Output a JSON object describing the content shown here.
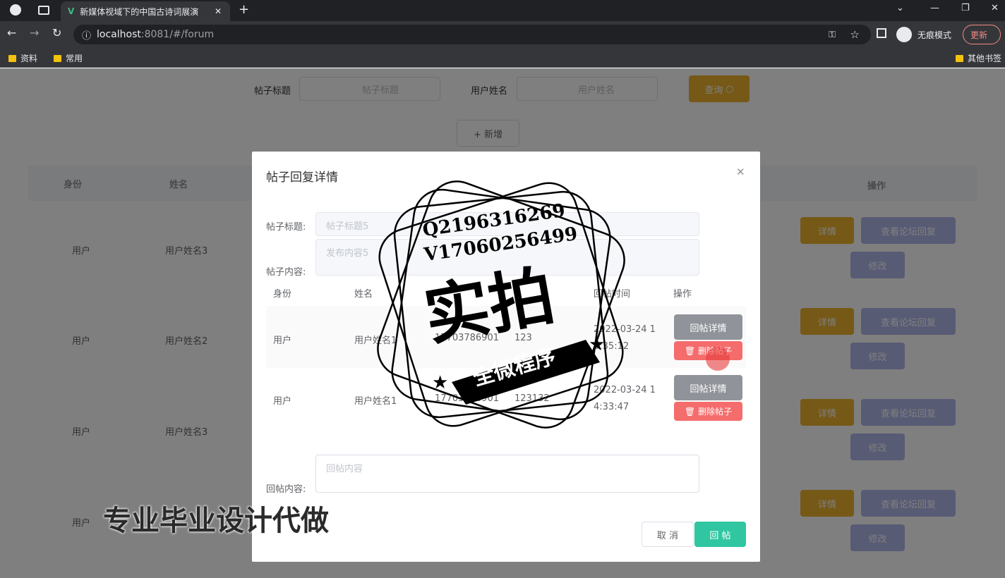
{
  "browser": {
    "tab_title": "新媒体视域下的中国古诗词展演",
    "new_tab": "+",
    "url_host": "localhost",
    "url_rest": ":8081/#/forum",
    "incognito": "无痕模式",
    "update": "更新",
    "bookmarks": [
      "资料",
      "常用"
    ],
    "other_bookmarks": "其他书签"
  },
  "search": {
    "title_label": "帖子标题",
    "title_placeholder": "帖子标题",
    "user_label": "用户姓名",
    "user_placeholder": "用户姓名",
    "query_button": "查询",
    "add_button": "+ 新增"
  },
  "table": {
    "headers": [
      "身份",
      "姓名",
      "操作"
    ],
    "rows": [
      {
        "identity": "用户",
        "name": "用户姓名3"
      },
      {
        "identity": "用户",
        "name": "用户姓名2"
      },
      {
        "identity": "用户",
        "name": "用户姓名3"
      },
      {
        "identity": "用户",
        "name": ""
      }
    ],
    "detail_btn": "详情",
    "view_reply_btn": "查看论坛回复",
    "edit_btn": "修改"
  },
  "modal": {
    "title": "帖子回复详情",
    "title_label": "帖子标题:",
    "title_value": "帖子标题5",
    "content_label": "帖子内容:",
    "content_value": "发布内容5",
    "sub_headers": [
      "身份",
      "姓名",
      "回帖时间",
      "操作"
    ],
    "replies": [
      {
        "identity": "用户",
        "name": "用户姓名1",
        "phone": "17703786901",
        "content": "123",
        "time": "2022-03-24 1",
        "time2": "3:35:12"
      },
      {
        "identity": "用户",
        "name": "用户姓名1",
        "phone": "17703786901",
        "content": "123132",
        "time": "2022-03-24 1",
        "time2": "4:33:47"
      }
    ],
    "reply_detail_btn": "回帖详情",
    "delete_btn": "删除帖子",
    "reply_content_label": "回帖内容:",
    "reply_content_placeholder": "回帖内容",
    "cancel_btn": "取 消",
    "reply_btn": "回 帖"
  },
  "watermark": {
    "line1": "Q2196316269",
    "line2": "V17060256499",
    "big": "实拍",
    "banner": "全微程序",
    "footer": "专业毕业设计代做"
  }
}
